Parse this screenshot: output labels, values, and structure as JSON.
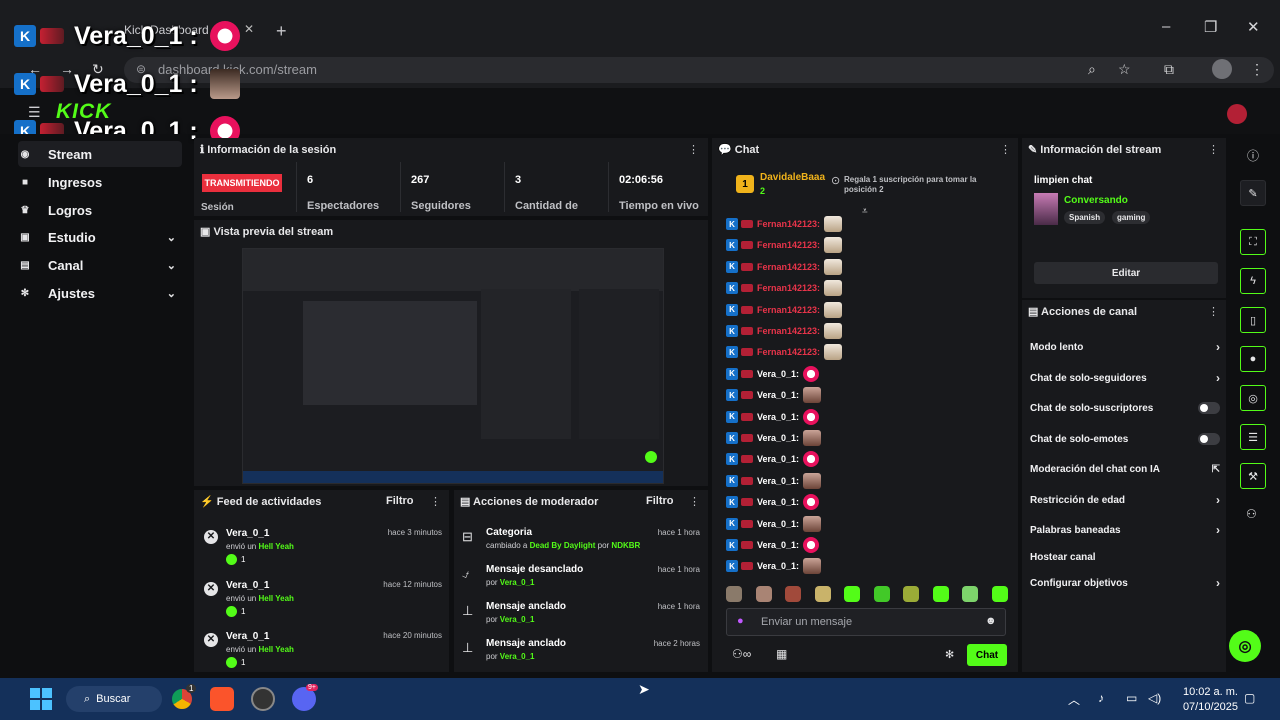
{
  "browser": {
    "tab_title": "Kick Dashboard",
    "url": "dashboard.kick.com/stream",
    "new_tab": "+",
    "minimize": "–",
    "restore": "❐",
    "close": "✕"
  },
  "site": {
    "logo": "KICK"
  },
  "overlay": {
    "lines": [
      {
        "name": "Vera_0_1 :"
      },
      {
        "name": "Vera_0_1 :"
      },
      {
        "name": "Vera_0_1 :"
      }
    ]
  },
  "sidebar": {
    "items": [
      {
        "label": "Stream",
        "icon": "broadcast-icon"
      },
      {
        "label": "Ingresos",
        "icon": "wallet-icon"
      },
      {
        "label": "Logros",
        "icon": "trophy-icon"
      },
      {
        "label": "Estudio",
        "icon": "studio-icon"
      },
      {
        "label": "Canal",
        "icon": "channel-icon"
      },
      {
        "label": "Ajustes",
        "icon": "gear-icon"
      }
    ]
  },
  "session": {
    "title": "Información de la sesión",
    "live_badge": "TRANSMITIENDO",
    "session_label": "Sesión",
    "stats": [
      {
        "value": "6",
        "label": "Espectadores"
      },
      {
        "value": "267",
        "label": "Seguidores"
      },
      {
        "value": "3",
        "label": "Cantidad de"
      },
      {
        "value": "02:06:56",
        "label": "Tiempo en vivo"
      }
    ]
  },
  "preview": {
    "title": "Vista previa del stream"
  },
  "feed": {
    "title": "Feed de actividades",
    "filter": "Filtro",
    "items": [
      {
        "user": "Vera_0_1",
        "time": "hace 3 minutos",
        "action": "envió un",
        "item": "Hell Yeah",
        "count": "1"
      },
      {
        "user": "Vera_0_1",
        "time": "hace 12 minutos",
        "action": "envió un",
        "item": "Hell Yeah",
        "count": "1"
      },
      {
        "user": "Vera_0_1",
        "time": "hace 20 minutos",
        "action": "envió un",
        "item": "Hell Yeah",
        "count": "1"
      }
    ]
  },
  "mod_actions": {
    "title": "Acciones de moderador",
    "filter": "Filtro",
    "items": [
      {
        "title": "Categoria",
        "time": "hace 1 hora",
        "detail_prefix": "cambiado a",
        "detail_value": "Dead By Daylight",
        "detail_mid": "por",
        "detail_user": "NDKBR"
      },
      {
        "title": "Mensaje desanclado",
        "time": "hace 1 hora",
        "detail_prefix": "por",
        "detail_value": "Vera_0_1",
        "detail_mid": "",
        "detail_user": ""
      },
      {
        "title": "Mensaje anclado",
        "time": "hace 1 hora",
        "detail_prefix": "por",
        "detail_value": "Vera_0_1",
        "detail_mid": "",
        "detail_user": ""
      },
      {
        "title": "Mensaje anclado",
        "time": "hace 2 horas",
        "detail_prefix": "por",
        "detail_value": "Vera_0_1",
        "detail_mid": "",
        "detail_user": ""
      }
    ]
  },
  "chat": {
    "title": "Chat",
    "pinned_user": "DavidaleBaaa",
    "pinned_rank": "1",
    "pinned_count": "2",
    "pinned_text": "Regala 1 suscripción para tomar la posición 2",
    "messages": [
      {
        "user": "Fernan142123:",
        "color": "#e8344a"
      },
      {
        "user": "Fernan142123:",
        "color": "#e8344a"
      },
      {
        "user": "Fernan142123:",
        "color": "#e8344a"
      },
      {
        "user": "Fernan142123:",
        "color": "#e8344a"
      },
      {
        "user": "Fernan142123:",
        "color": "#e8344a"
      },
      {
        "user": "Fernan142123:",
        "color": "#e8344a"
      },
      {
        "user": "Fernan142123:",
        "color": "#e8344a"
      },
      {
        "user": "Vera_0_1:",
        "color": "#ffffff"
      },
      {
        "user": "Vera_0_1:",
        "color": "#ffffff"
      },
      {
        "user": "Vera_0_1:",
        "color": "#ffffff"
      },
      {
        "user": "Vera_0_1:",
        "color": "#ffffff"
      },
      {
        "user": "Vera_0_1:",
        "color": "#ffffff"
      },
      {
        "user": "Vera_0_1:",
        "color": "#ffffff"
      },
      {
        "user": "Vera_0_1:",
        "color": "#ffffff"
      },
      {
        "user": "Vera_0_1:",
        "color": "#ffffff"
      },
      {
        "user": "Vera_0_1:",
        "color": "#ffffff"
      },
      {
        "user": "Vera_0_1:",
        "color": "#ffffff"
      }
    ],
    "input_placeholder": "Enviar un mensaje",
    "send_label": "Chat"
  },
  "stream_info": {
    "title": "Información del stream",
    "stream_title": "limpien chat",
    "category": "Conversando",
    "tags": [
      "Spanish",
      "gaming"
    ],
    "edit_label": "Editar"
  },
  "channel_actions": {
    "title": "Acciones de canal",
    "items": [
      {
        "label": "Modo lento",
        "control": "arrow"
      },
      {
        "label": "Chat de solo-seguidores",
        "control": "arrow"
      },
      {
        "label": "Chat de solo-suscriptores",
        "control": "toggle"
      },
      {
        "label": "Chat de solo-emotes",
        "control": "toggle"
      },
      {
        "label": "Moderación del chat con IA",
        "control": "external"
      },
      {
        "label": "Restricción de edad",
        "control": "arrow"
      },
      {
        "label": "Palabras baneadas",
        "control": "arrow"
      },
      {
        "label": "Hostear canal",
        "control": "none"
      },
      {
        "label": "Configurar objetivos",
        "control": "arrow"
      }
    ]
  },
  "taskbar": {
    "search": "Buscar",
    "time": "10:02 a. m.",
    "date": "07/10/2025",
    "chrome_badge": "1",
    "discord_badge": "9+"
  },
  "colors": {
    "accent": "#53fc18",
    "live": "#ea2f3d",
    "panel": "#18191c",
    "taskbar": "#14305a"
  }
}
